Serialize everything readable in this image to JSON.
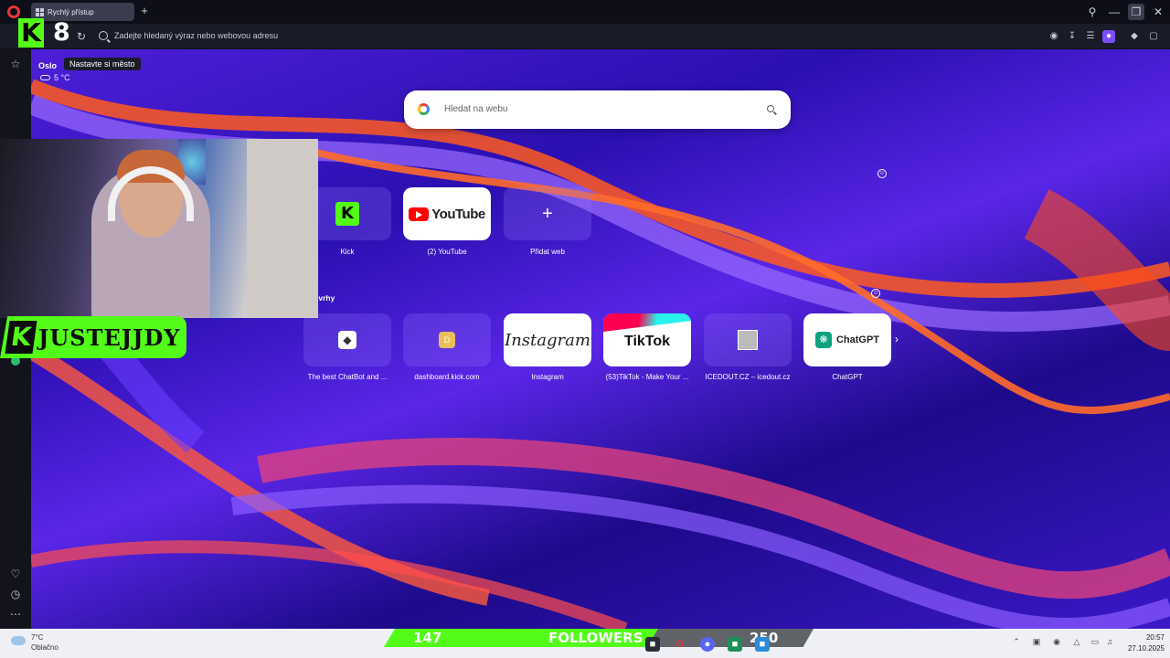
{
  "tabs": [
    {
      "title": "Rychlý přístup"
    }
  ],
  "address_bar": {
    "placeholder": "Zadejte hledaný výraz nebo webovou adresu"
  },
  "weather": {
    "city": "Oslo",
    "tooltip": "Nastavte si město",
    "temperature": "5 °C"
  },
  "search": {
    "placeholder": "Hledat na webu"
  },
  "speed_dial": [
    {
      "label": "Kick",
      "icon": "kick-logo"
    },
    {
      "label": "(2) YouTube",
      "logo_text": "YouTube"
    },
    {
      "label": "Přidat web",
      "icon": "plus-icon"
    }
  ],
  "suggestions": {
    "heading": "ivrhy",
    "items": [
      {
        "label": "The best ChatBot and ...",
        "icon": "chatbot-icon"
      },
      {
        "label": "dashboard.kick.com",
        "logo_text": "D"
      },
      {
        "label": "Instagram",
        "logo_text": "Instagram"
      },
      {
        "label": "(53)TikTok - Make Your ...",
        "logo_text": "TikTok"
      },
      {
        "label": "ICEDOUT.CZ – icedout.cz",
        "icon": "image-icon"
      },
      {
        "label": "ChatGPT",
        "logo_text": "ChatGPT"
      }
    ]
  },
  "stream": {
    "viewer_count": "8",
    "streamer_name": "JUSTEJJDY",
    "followers": {
      "current": "147",
      "label": "FOLLOWERS",
      "goal": "250",
      "progress": 0.588
    }
  },
  "taskbar": {
    "weather_temp": "7°C",
    "weather_desc": "Oblačno",
    "time": "20:57",
    "date": "27.10.2025"
  },
  "colors": {
    "kick_green": "#53fc18",
    "opera_red": "#e8343d",
    "accent_purple": "#7b4dff"
  }
}
